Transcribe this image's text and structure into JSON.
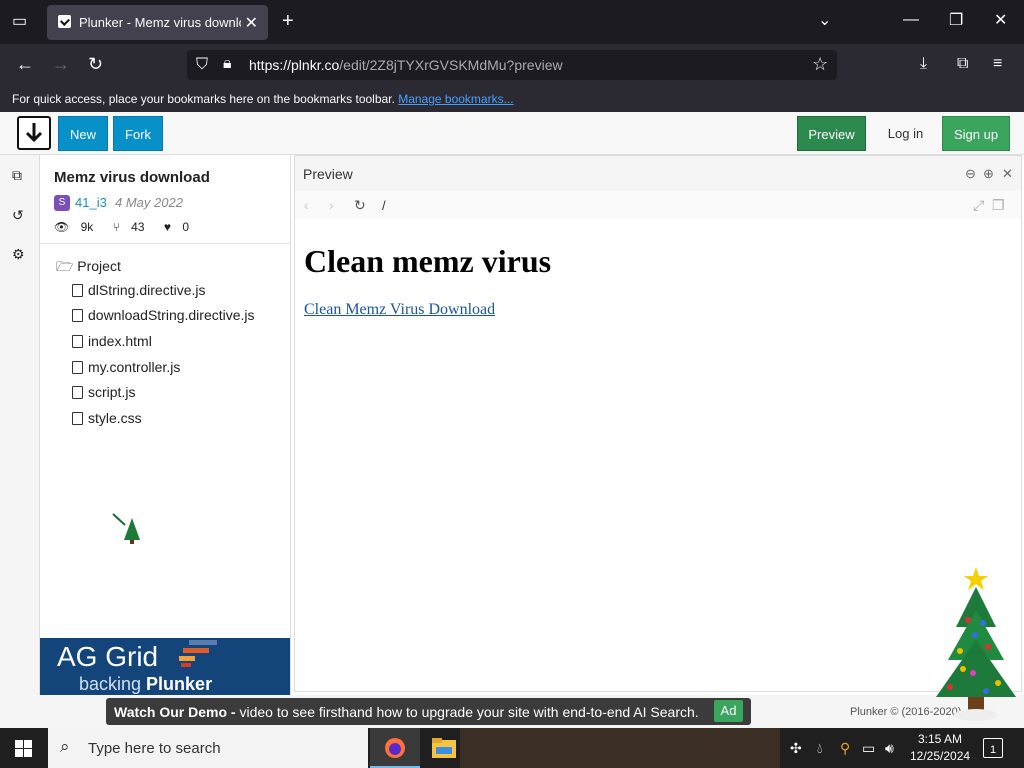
{
  "browser": {
    "tab_title": "Plunker - Memz virus downloac",
    "url_domain": "https://plnkr.co",
    "url_path": "/edit/2Z8jTYXrGVSKMdMu?preview",
    "bookmarks_text": "For quick access, place your bookmarks here on the bookmarks toolbar.",
    "bookmarks_link": "Manage bookmarks..."
  },
  "header": {
    "new_label": "New",
    "fork_label": "Fork",
    "preview_label": "Preview",
    "login_label": "Log in",
    "signup_label": "Sign up"
  },
  "project": {
    "title": "Memz virus download",
    "avatar_letter": "S",
    "author": "41_i3",
    "date": "4 May 2022",
    "views": "9k",
    "forks": "43",
    "likes": "0",
    "folder": "Project",
    "files": [
      "dlString.directive.js",
      "downloadString.directive.js",
      "index.html",
      "my.controller.js",
      "script.js",
      "style.css"
    ]
  },
  "ad": {
    "big": "AG Grid",
    "small_prefix": "backing ",
    "small_bold": "Plunker"
  },
  "preview": {
    "label": "Preview",
    "path": "/",
    "heading": "Clean memz virus",
    "link": "Clean Memz Virus Download"
  },
  "banner": {
    "bold": "Watch Our Demo -",
    "text": " video to see firsthand how to upgrade your site with end-to-end AI Search.",
    "ad": "Ad"
  },
  "footer": {
    "copyright": "Plunker © (2016-2020)"
  },
  "taskbar": {
    "search_placeholder": "Type here to search",
    "time": "3:15 AM",
    "date": "12/25/2024",
    "notification_count": "1"
  }
}
